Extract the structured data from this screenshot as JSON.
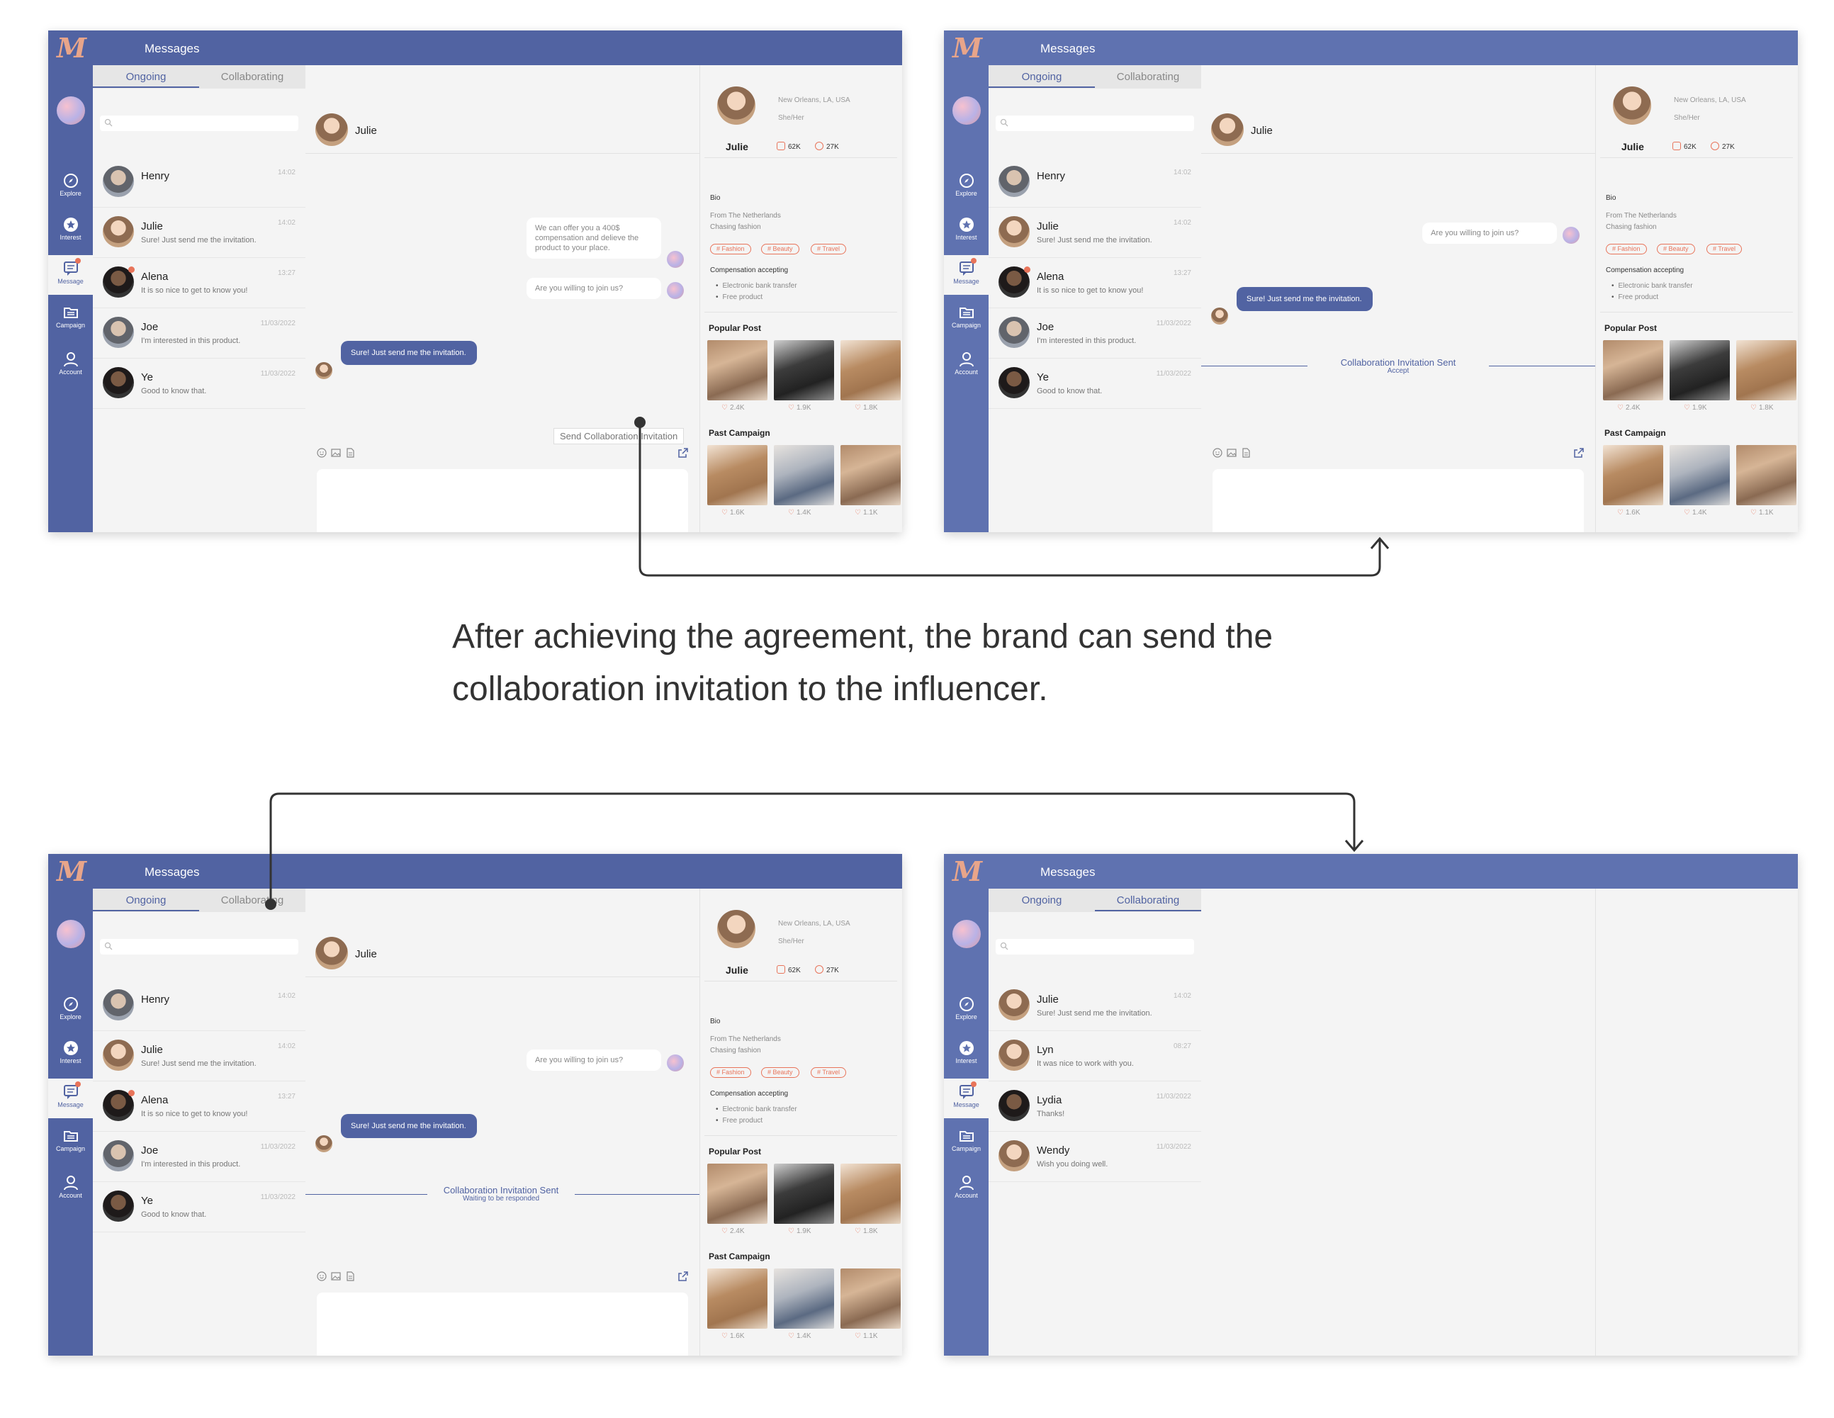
{
  "app": {
    "logo": "M",
    "title": "Messages"
  },
  "nav": [
    {
      "label": "Explore",
      "icon": "compass-icon"
    },
    {
      "label": "Interest",
      "icon": "star-icon"
    },
    {
      "label": "Message",
      "icon": "chat-icon"
    },
    {
      "label": "Campaign",
      "icon": "folder-icon"
    },
    {
      "label": "Account",
      "icon": "user-icon"
    }
  ],
  "tabs": {
    "ongoing": "Ongoing",
    "collaborating": "Collaborating"
  },
  "conversations": [
    {
      "name": "Henry",
      "preview": "",
      "time": "14:02"
    },
    {
      "name": "Julie",
      "preview": "Sure! Just send me the invitation.",
      "time": "14:02"
    },
    {
      "name": "Alena",
      "preview": "It is so nice to get to know you!",
      "time": "13:27"
    },
    {
      "name": "Joe",
      "preview": "I'm interested in this product.",
      "time": "11/03/2022"
    },
    {
      "name": "Ye",
      "preview": "Good to know that.",
      "time": "11/03/2022"
    }
  ],
  "collab_conversations": [
    {
      "name": "Julie",
      "preview": "Sure! Just send me the invitation.",
      "time": "14:02"
    },
    {
      "name": "Lyn",
      "preview": "It was nice to work with you.",
      "time": "08:27"
    },
    {
      "name": "Lydia",
      "preview": "Thanks!",
      "time": "11/03/2022"
    },
    {
      "name": "Wendy",
      "preview": "Wish you doing well.",
      "time": "11/03/2022"
    }
  ],
  "chat": {
    "contact": "Julie",
    "msg_offer": "We can offer you a 400$ compensation and delieve the product to your place.",
    "msg_join": "Are you willing to join us?",
    "msg_reply": "Sure! Just send me the invitation.",
    "send_button": "Send Collaboration Invitation",
    "sent_title": "Collaboration Invitation Sent",
    "sent_accept": "Accept",
    "sent_waiting": "Waiting to be responded"
  },
  "profile": {
    "location": "New Orleans, LA, USA",
    "pronouns": "She/Her",
    "name": "Julie",
    "instagram": "62K",
    "tiktok": "27K",
    "bio_heading": "Bio",
    "bio_line1": "From The Netherlands",
    "bio_line2": "Chasing fashion",
    "tags": [
      "# Fashion",
      "# Beauty",
      "# Travel"
    ],
    "comp_heading": "Compensation accepting",
    "comp_items": [
      "Electronic bank transfer",
      "Free product"
    ],
    "popular_heading": "Popular Post",
    "popular_likes": [
      "2.4K",
      "1.9K",
      "1.8K"
    ],
    "past_heading": "Past Campaign",
    "past_likes": [
      "1.6K",
      "1.4K",
      "1.1K"
    ]
  },
  "caption": {
    "line1": "After achieving the agreement, the brand can send the",
    "line2": "collaboration invitation to the influencer."
  },
  "colors": {
    "primary": "#5163a2",
    "accent": "#e8745a",
    "background": "#f4f4f4"
  }
}
